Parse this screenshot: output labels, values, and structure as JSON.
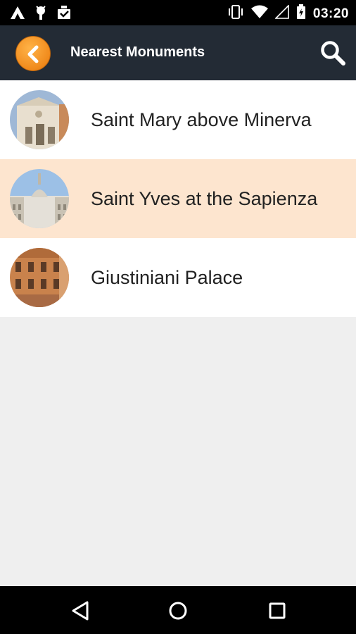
{
  "status_bar": {
    "time": "03:20",
    "left_icons": [
      "app-notification-icon",
      "android-debug-icon",
      "download-done-icon"
    ],
    "right_icons": [
      "vibrate-icon",
      "wifi-icon",
      "signal-icon",
      "battery-icon"
    ]
  },
  "app_bar": {
    "title": "Nearest Monuments",
    "back_icon": "back-arrow-icon",
    "search_icon": "search-icon",
    "accent_color": "#f08a1c",
    "background_color": "#232b35"
  },
  "monuments": [
    {
      "label": "Saint Mary above Minerva",
      "highlighted": false
    },
    {
      "label": "Saint Yves at the Sapienza",
      "highlighted": true
    },
    {
      "label": "Giustiniani Palace",
      "highlighted": false
    }
  ],
  "highlight_color": "#fde5cf",
  "nav_bar": {
    "buttons": [
      "back-triangle-icon",
      "home-circle-icon",
      "recents-square-icon"
    ]
  }
}
